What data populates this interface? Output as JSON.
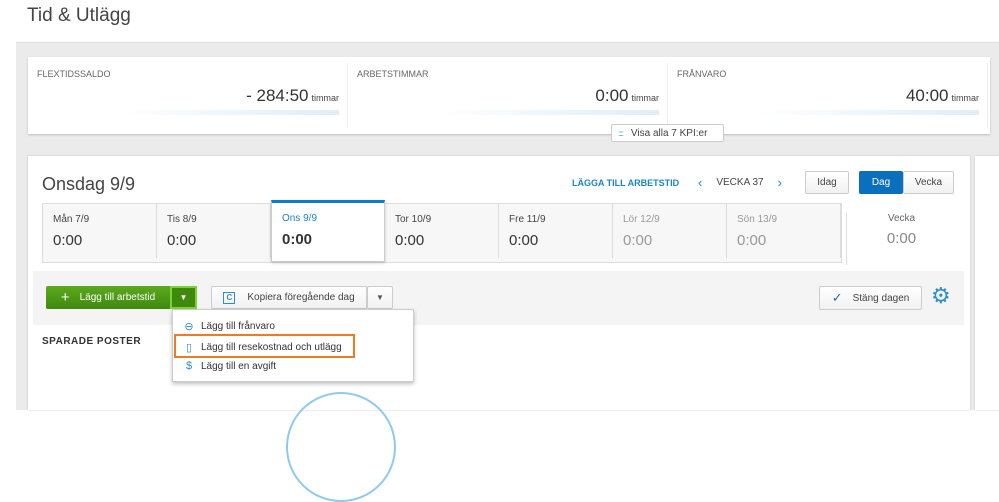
{
  "page_title": "Tid & Utlägg",
  "kpis": [
    {
      "label": "FLEXTIDSSALDO",
      "value": "- 284:50",
      "unit": "timmar"
    },
    {
      "label": "ARBETSTIMMAR",
      "value": "0:00",
      "unit": "timmar"
    },
    {
      "label": "FRÅNVARO",
      "value": "40:00",
      "unit": "timmar"
    }
  ],
  "kpi_more": "Visa alla 7 KPI:er",
  "day": {
    "title": "Onsdag 9/9",
    "add_link": "LÄGGA TILL ARBETSTID",
    "week_label": "VECKA 37",
    "today": "Idag",
    "view_day": "Dag",
    "view_week": "Vecka"
  },
  "week_days": [
    {
      "label": "Mån 7/9",
      "value": "0:00"
    },
    {
      "label": "Tis 8/9",
      "value": "0:00"
    },
    {
      "label": "Ons 9/9",
      "value": "0:00"
    },
    {
      "label": "Tor 10/9",
      "value": "0:00"
    },
    {
      "label": "Fre 11/9",
      "value": "0:00"
    },
    {
      "label": "Lör 12/9",
      "value": "0:00"
    },
    {
      "label": "Sön 13/9",
      "value": "0:00"
    }
  ],
  "week_total": {
    "label": "Vecka",
    "value": "0:00"
  },
  "toolbar": {
    "add_work": "Lägg till arbetstid",
    "copy_prev": "Kopiera föregående dag",
    "close_day": "Stäng dagen"
  },
  "saved_title": "SPARADE POSTER",
  "menu": [
    "Lägg till frånvaro",
    "Lägg till resekostnad och utlägg",
    "Lägg till en avgift"
  ],
  "colors": {
    "accent": "#0a6fbc",
    "green": "#4a9a15",
    "highlight": "#f07a21"
  }
}
